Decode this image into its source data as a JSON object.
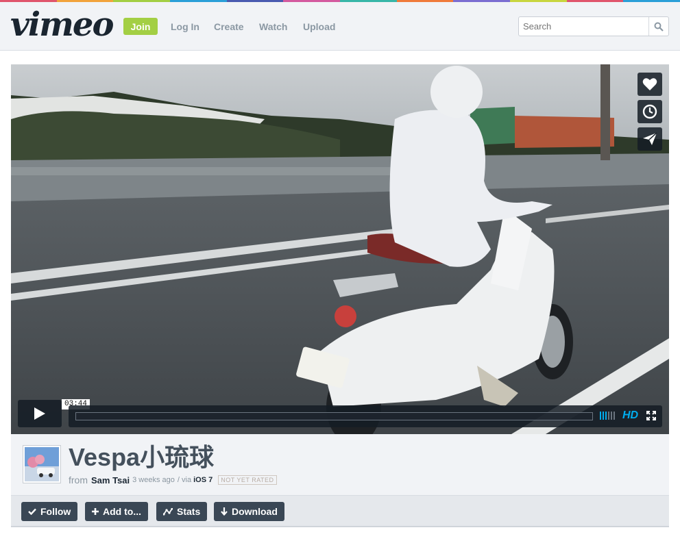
{
  "brand": {
    "logo_text": "vimeo",
    "stripe_colors": [
      "#e0556c",
      "#f2a33c",
      "#a3cf44",
      "#2a9fd8",
      "#4a5bb0",
      "#d45a9f",
      "#38b6a8",
      "#f07a3a",
      "#7b6dd1",
      "#c8d63f",
      "#e0556c",
      "#2a9fd8"
    ]
  },
  "header": {
    "join_label": "Join",
    "nav": [
      "Log In",
      "Create",
      "Watch",
      "Upload"
    ],
    "search_placeholder": "Search"
  },
  "player": {
    "timecode": "03:44",
    "progress": 0,
    "hd_label": "HD",
    "side_actions": [
      "heart-icon",
      "clock-icon",
      "send-icon"
    ]
  },
  "video": {
    "title": "Vespa小琉球",
    "from_label": "from",
    "author": "Sam Tsai",
    "time_ago": "3 weeks ago",
    "via_label": "/ via",
    "platform": "iOS 7",
    "rating": "NOT YET RATED"
  },
  "actions": [
    {
      "label": "Follow",
      "icon": "check-icon"
    },
    {
      "label": "Add to...",
      "icon": "plus-icon"
    },
    {
      "label": "Stats",
      "icon": "stats-icon"
    },
    {
      "label": "Download",
      "icon": "download-icon"
    }
  ],
  "colors": {
    "accent_green": "#a3cf44",
    "accent_blue": "#00adef",
    "button_dark": "#3a4755"
  }
}
